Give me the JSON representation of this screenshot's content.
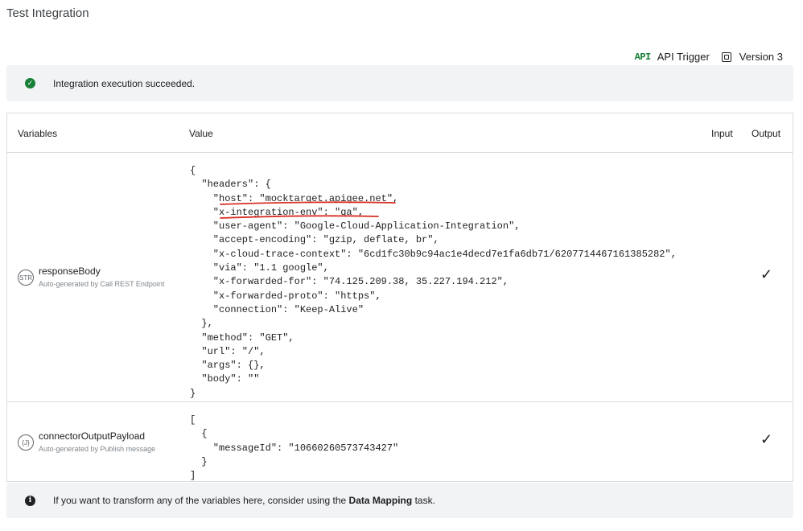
{
  "title": "Test Integration",
  "meta": {
    "trigger_icon": "API",
    "trigger_label": "API Trigger",
    "version_icon": "version-icon",
    "version_label": "Version 3"
  },
  "success_banner": {
    "icon": "check-circle-icon",
    "text": "Integration execution succeeded."
  },
  "table": {
    "headers": {
      "variables": "Variables",
      "value": "Value",
      "input": "Input",
      "output": "Output"
    },
    "rows": [
      {
        "type": "STR",
        "name": "responseBody",
        "sub": "Auto-generated by Call REST Endpoint",
        "value": "{\n  \"headers\": {\n    \"host\": \"mocktarget.apigee.net\",\n    \"x-integration-env\": \"qa\",\n    \"user-agent\": \"Google-Cloud-Application-Integration\",\n    \"accept-encoding\": \"gzip, deflate, br\",\n    \"x-cloud-trace-context\": \"6cd1fc30b9c94ac1e4decd7e1fa6db71/6207714467161385282\",\n    \"via\": \"1.1 google\",\n    \"x-forwarded-for\": \"74.125.209.38, 35.227.194.212\",\n    \"x-forwarded-proto\": \"https\",\n    \"connection\": \"Keep-Alive\"\n  },\n  \"method\": \"GET\",\n  \"url\": \"/\",\n  \"args\": {},\n  \"body\": \"\"\n}",
        "output_mark": "✓"
      },
      {
        "type": "{J}",
        "name": "connectorOutputPayload",
        "sub": "Auto-generated by Publish message",
        "value": "[\n  {\n    \"messageId\": \"10660260573743427\"\n  }\n]",
        "output_mark": "✓"
      }
    ]
  },
  "info_banner": {
    "icon": "info-icon",
    "text_before": "If you want to transform any of the variables here, consider using the",
    "link": "Data Mapping",
    "text_after": "task."
  },
  "colors": {
    "success": "#188038",
    "annotation": "#d93025",
    "banner_bg": "#f1f3f4",
    "border": "#dadce0"
  }
}
